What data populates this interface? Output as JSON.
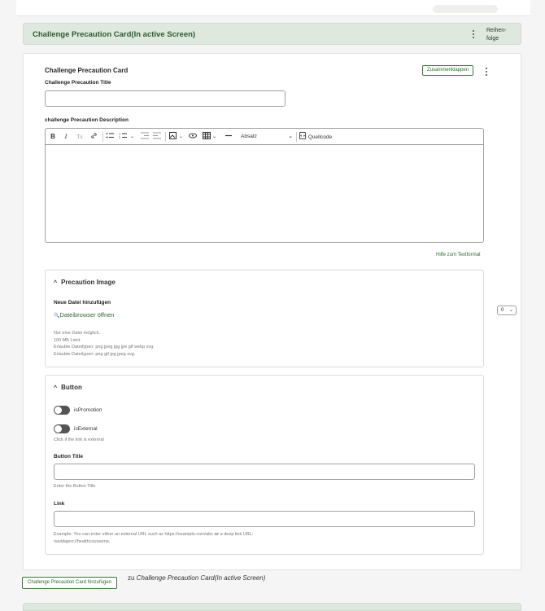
{
  "section": {
    "title": "Challenge Precaution Card(In active Screen)",
    "weight_label_1": "Reihen-",
    "weight_label_2": "folge"
  },
  "card": {
    "title": "Challenge Precaution Card",
    "collapse_label": "Zusammenklappen",
    "title_field_label": "Challenge Precaution Title",
    "title_field_value": "",
    "description_label": "challenge Precaution Description",
    "editor": {
      "toolbar": {
        "bold": "B",
        "italic": "I",
        "remove_format": "Tx",
        "format_select": "Absatz",
        "source_label": "Quellcode"
      },
      "content": ""
    },
    "help_link": "Hilfe zum Textformat"
  },
  "image_fieldset": {
    "legend": "Precaution Image",
    "new_file_label": "Neue Datei hinzufügen",
    "browse_label": "Dateibrowser öffnen",
    "help_lines": [
      "Nur eine Datei möglich.",
      "100 MB Limit.",
      "Erlaubte Dateitypen: png jpeg jpg jpe gif webp svg.",
      "Erlaubte Dateitypen: png gif jpg jpeg svg."
    ]
  },
  "button_fieldset": {
    "legend": "Button",
    "is_promotion_label": "isPromotion",
    "is_promotion_on": false,
    "is_external_label": "isExternal",
    "is_external_on": false,
    "is_external_help": "Click if the link is external",
    "button_title_label": "Button Title",
    "button_title_value": "",
    "button_title_help": "Enter the Button Title",
    "link_label": "Link",
    "link_value": "",
    "link_help_1": "Example: You can enter either an external URL such as https://example.com/abc ",
    "link_help_or": "or",
    "link_help_2": " a deep link URL:",
    "link_help_3": "navidapro://healthcourseme."
  },
  "weight_select": {
    "value": "0"
  },
  "add_button": {
    "label": "Challenge Precaution Card hinzufügen",
    "suffix_prefix": "zu ",
    "suffix_target": "Challenge Precaution Card(In active Screen)"
  },
  "colors": {
    "accent": "#2e6a2e",
    "header_bg": "#dfe8df"
  }
}
